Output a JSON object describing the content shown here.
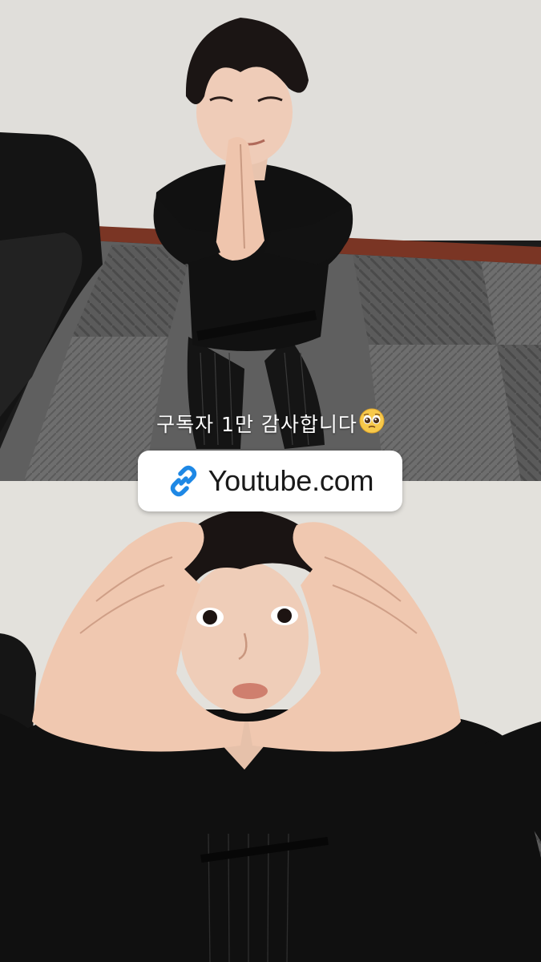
{
  "story": {
    "caption_text": "구독자  1만  감사합니다",
    "caption_emoji": "pleading-face-emoji",
    "link_sticker": {
      "label": "Youtube.com",
      "icon": "link-icon",
      "accent_color": "#1e88e5"
    }
  }
}
